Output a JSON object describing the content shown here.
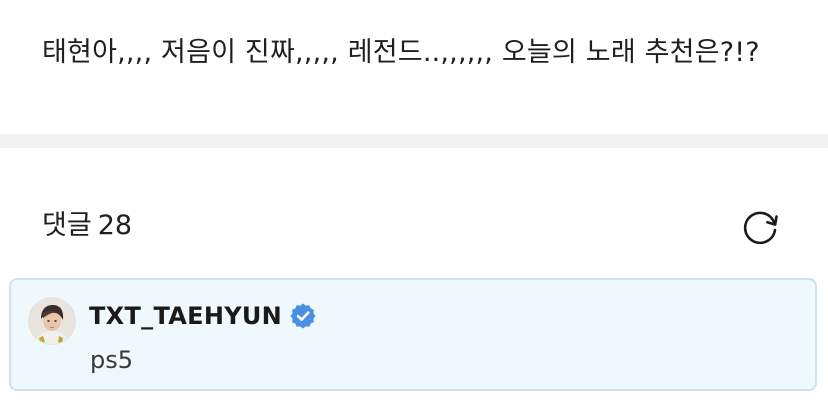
{
  "post": {
    "text": "태현아,,,, 저음이 진짜,,,,, 레전드..,,,,,,  오늘의 노래 추천은?!?"
  },
  "comments": {
    "label": "댓글",
    "count": "28",
    "refresh_icon": "refresh-icon"
  },
  "comment": {
    "author": "TXT_TAEHYUN",
    "verified_icon": "verified-badge-icon",
    "text": "ps5",
    "highlight_color": "#eef8fd",
    "verified_color": "#4a90e2"
  }
}
